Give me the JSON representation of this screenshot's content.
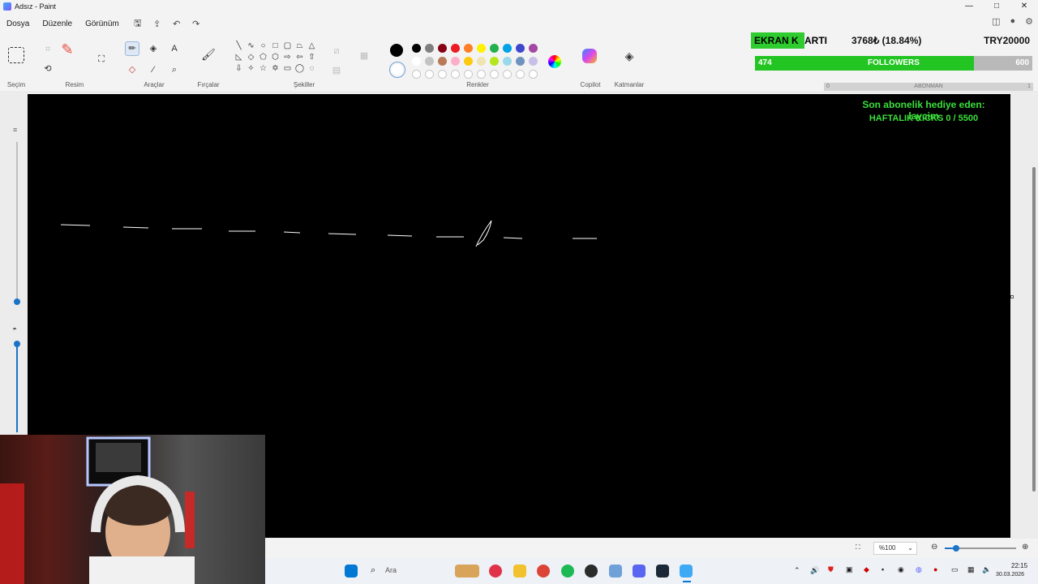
{
  "window": {
    "title": "Adsız - Paint",
    "controls": [
      "—",
      "□",
      "✕"
    ]
  },
  "menu": {
    "file": "Dosya",
    "edit": "Düzenle",
    "view": "Görünüm"
  },
  "ribbon": {
    "groups": {
      "selection": "Seçim",
      "image": "Resim",
      "tools": "Araçlar",
      "brushes": "Fırçalar",
      "shapes": "Şekiller",
      "colors": "Renkler",
      "copilot": "Copilot",
      "layers": "Katmanlar"
    },
    "palette_row1": [
      "#000000",
      "#7f7f7f",
      "#880015",
      "#ed1c24",
      "#ff7f27",
      "#fff200",
      "#22b14c",
      "#00a2e8",
      "#3f48cc",
      "#a349a4"
    ],
    "palette_row2": [
      "#ffffff",
      "#c3c3c3",
      "#b97a57",
      "#ffaec9",
      "#ffc90e",
      "#efe4b0",
      "#b5e61d",
      "#99d9ea",
      "#7092be",
      "#c8bfe7"
    ],
    "primary_color": "#000000",
    "secondary_color": "#ffffff"
  },
  "overlay": {
    "gpu_label_a": "EKRAN K",
    "gpu_label_b": "ARTI",
    "gpu_value": "3768₺ (18.84%)",
    "gpu_target": "TRY20000",
    "followers_current": "474",
    "followers_label": "FOLLOWERS",
    "followers_goal": "600",
    "followers_fraction": 0.79,
    "sub_start": "0",
    "sub_label": "ABONMAN",
    "sub_end": "1",
    "sub_fraction": 0.0,
    "last_gift": "Son abonelik hediye eden: laycim",
    "weekly_kicks": "HAFTALIK KICKS 0 / 5500"
  },
  "status": {
    "zoom": "%100"
  },
  "taskbar": {
    "search_placeholder": "Ara",
    "time": "22:15",
    "date": "30.03.2026"
  }
}
